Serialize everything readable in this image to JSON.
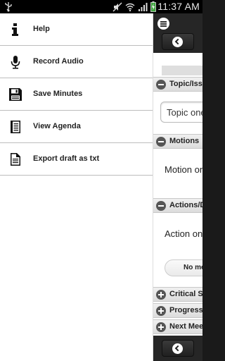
{
  "status_bar": {
    "time": "11:37 AM",
    "icons": [
      "usb-icon",
      "mute-icon",
      "wifi-icon",
      "signal-icon",
      "battery-charging-icon"
    ]
  },
  "drawer": {
    "items": [
      {
        "label": "Help",
        "icon": "info-icon"
      },
      {
        "label": "Record Audio",
        "icon": "microphone-icon"
      },
      {
        "label": "Save Minutes",
        "icon": "floppy-disk-icon"
      },
      {
        "label": "View Agenda",
        "icon": "book-icon"
      },
      {
        "label": "Export draft as txt",
        "icon": "document-icon"
      }
    ]
  },
  "background_app": {
    "sections": [
      {
        "title": "Topic/Issue",
        "expanded": true,
        "field_text": "Topic one"
      },
      {
        "title": "Motions",
        "expanded": true,
        "body_text": "Motion one"
      },
      {
        "title": "Actions/Decisions",
        "expanded": true,
        "body_text": "Action one",
        "button_label": "No more"
      },
      {
        "title": "Critical Success",
        "expanded": false
      },
      {
        "title": "Progress",
        "expanded": false
      },
      {
        "title": "Next Meeting",
        "expanded": false
      }
    ]
  }
}
